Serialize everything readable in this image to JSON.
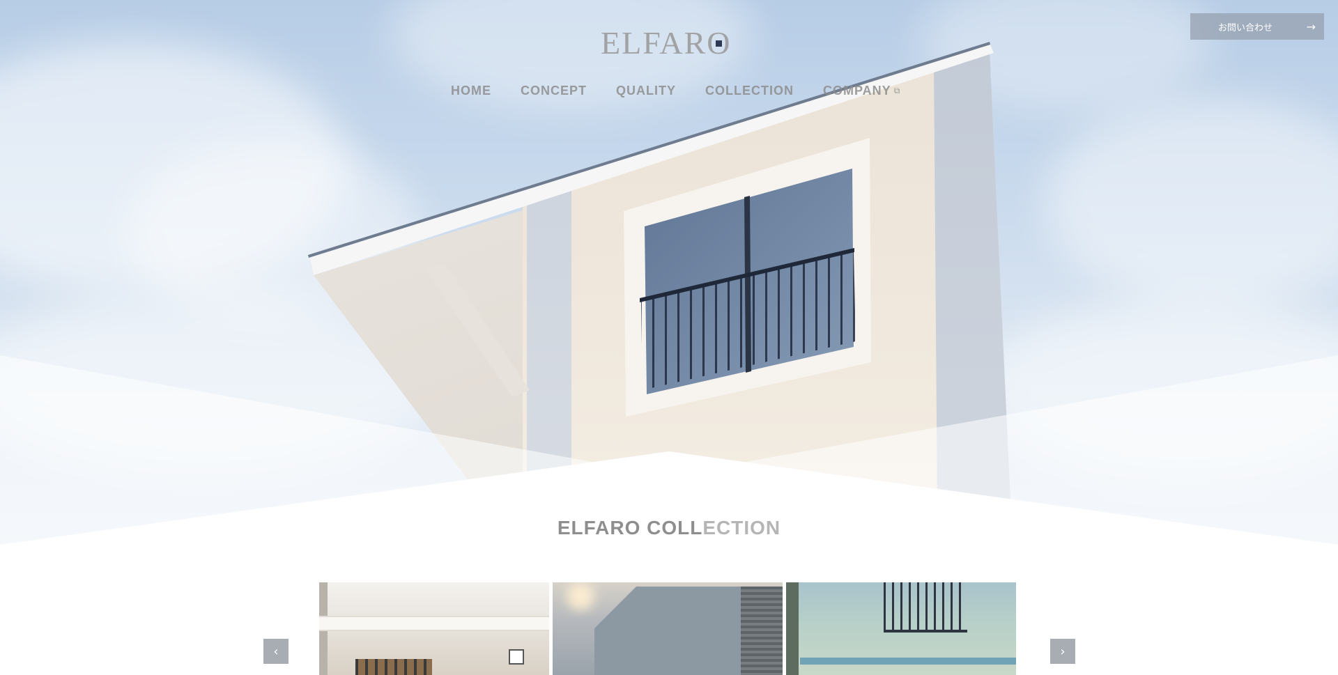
{
  "header": {
    "logo_text": "ELFARO",
    "contact_button": {
      "label": "お問い合わせ",
      "arrow": "→"
    }
  },
  "nav": {
    "items": [
      {
        "label": "HOME"
      },
      {
        "label": "CONCEPT"
      },
      {
        "label": "QUALITY"
      },
      {
        "label": "COLLECTION"
      },
      {
        "label": "COMPANY",
        "external_icon": "⧉"
      }
    ]
  },
  "collection": {
    "title_part1": "ELFARO COLL",
    "title_part2": "ECTION",
    "prev_glyph": "‹",
    "next_glyph": "›"
  },
  "colors": {
    "nav_text": "#8c8c8c",
    "button_bg": "#96a0af",
    "slider_arrow_bg": "#a8adb4"
  }
}
